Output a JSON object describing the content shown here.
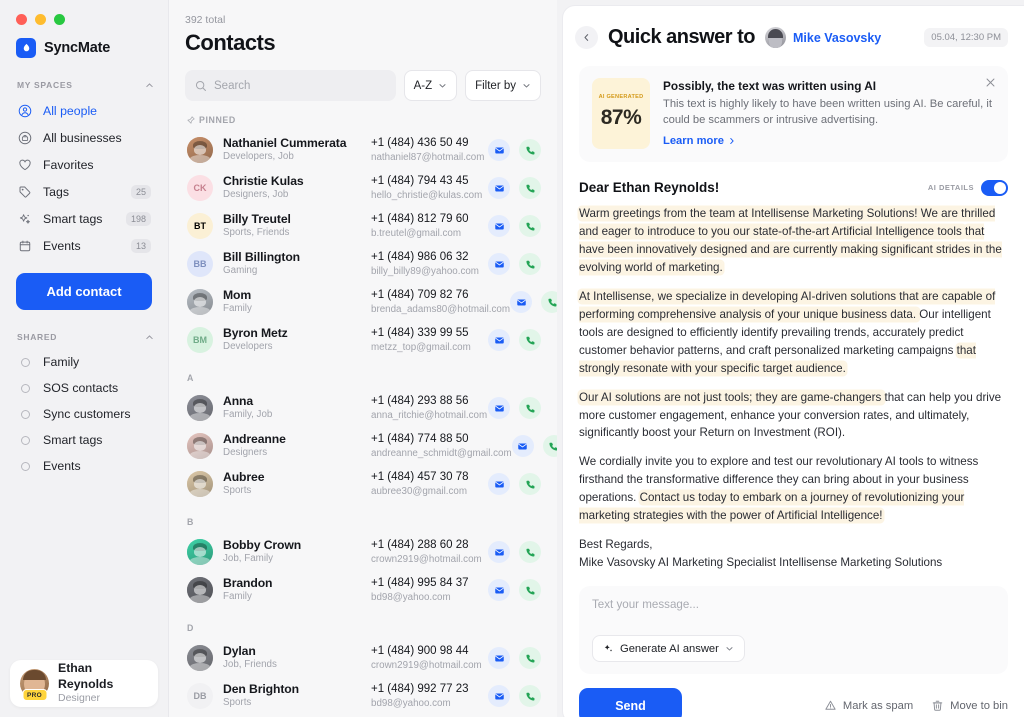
{
  "app": {
    "brand": "SyncMate"
  },
  "sidebar": {
    "my_spaces": {
      "title": "MY SPACES",
      "items": [
        {
          "label": "All people",
          "icon": "person-circle-icon",
          "badge": "",
          "active": true
        },
        {
          "label": "All businesses",
          "icon": "briefcase-circle-icon",
          "badge": "",
          "active": false
        },
        {
          "label": "Favorites",
          "icon": "heart-icon",
          "badge": "",
          "active": false
        },
        {
          "label": "Tags",
          "icon": "tag-icon",
          "badge": "25",
          "active": false
        },
        {
          "label": "Smart tags",
          "icon": "sparkles-icon",
          "badge": "198",
          "active": false
        },
        {
          "label": "Events",
          "icon": "calendar-icon",
          "badge": "13",
          "active": false
        }
      ]
    },
    "add_contact_label": "Add contact",
    "shared": {
      "title": "SHARED",
      "items": [
        {
          "label": "Family"
        },
        {
          "label": "SOS contacts"
        },
        {
          "label": "Sync customers"
        },
        {
          "label": "Smart tags"
        },
        {
          "label": "Events"
        }
      ]
    },
    "user": {
      "name": "Ethan Reynolds",
      "role": "Designer",
      "badge": "PRO"
    }
  },
  "contacts": {
    "total": "392 total",
    "title": "Contacts",
    "search_placeholder": "Search",
    "search_value": "",
    "sort_label": "A-Z",
    "filter_label": "Filter by",
    "groups": [
      {
        "label": "PINNED",
        "pinned": true,
        "rows": [
          {
            "name": "Nathaniel Cummerata",
            "tags": "Developers, Job",
            "phone": "+1 (484) 436 50 49",
            "email": "nathaniel87@hotmail.com",
            "initials": "NC",
            "avatar_type": "photo",
            "avatar_bg": "#c8906a",
            "avatar_fg": "#ffffff"
          },
          {
            "name": "Christie Kulas",
            "tags": "Designers, Job",
            "phone": "+1 (484) 794 43 45",
            "email": "hello_christie@kulas.com",
            "initials": "CK",
            "avatar_type": "initials",
            "avatar_bg": "#fbdfe4",
            "avatar_fg": "#c6808e"
          },
          {
            "name": "Billy Treutel",
            "tags": "Sports, Friends",
            "phone": "+1 (484) 812 79 60",
            "email": "b.treutel@gmail.com",
            "initials": "BT",
            "avatar_type": "initials",
            "avatar_bg": "#fbf0d5",
            "avatar_fg": "#c3a濃56"
          },
          {
            "name": "Bill Billington",
            "tags": "Gaming",
            "phone": "+1 (484) 986 06 32",
            "email": "billy_billy89@yahoo.com",
            "initials": "BB",
            "avatar_type": "initials",
            "avatar_bg": "#dfe6fa",
            "avatar_fg": "#7e8fbe"
          },
          {
            "name": "Mom",
            "tags": "Family",
            "phone": "+1 (484) 709 82 76",
            "email": "brenda_adams80@hotmail.com",
            "initials": "M",
            "avatar_type": "photo",
            "avatar_bg": "#b9bfc6",
            "avatar_fg": "#ffffff"
          },
          {
            "name": "Byron Metz",
            "tags": "Developers",
            "phone": "+1 (484) 339 99 55",
            "email": "metzz_top@gmail.com",
            "initials": "BM",
            "avatar_type": "initials",
            "avatar_bg": "#d8f2e0",
            "avatar_fg": "#70ab88"
          }
        ]
      },
      {
        "label": "A",
        "pinned": false,
        "rows": [
          {
            "name": "Anna",
            "tags": "Family, Job",
            "phone": "+1 (484) 293 88 56",
            "email": "anna_ritchie@hotmail.com",
            "initials": "A",
            "avatar_type": "photo",
            "avatar_bg": "#8d8f98",
            "avatar_fg": "#ffffff"
          },
          {
            "name": "Andreanne",
            "tags": "Designers",
            "phone": "+1 (484) 774 88 50",
            "email": "andreanne_schmidt@gmail.com",
            "initials": "A",
            "avatar_type": "photo",
            "avatar_bg": "#e6c6c0",
            "avatar_fg": "#ffffff"
          },
          {
            "name": "Aubree",
            "tags": "Sports",
            "phone": "+1 (484) 457 30 78",
            "email": "aubree30@gmail.com",
            "initials": "A",
            "avatar_type": "photo",
            "avatar_bg": "#ddc9a8",
            "avatar_fg": "#ffffff"
          }
        ]
      },
      {
        "label": "B",
        "pinned": false,
        "rows": [
          {
            "name": "Bobby Crown",
            "tags": "Job, Family",
            "phone": "+1 (484) 288 60 28",
            "email": "crown2919@hotmail.com",
            "initials": "BC",
            "avatar_type": "photo",
            "avatar_bg": "#3fd3a8",
            "avatar_fg": "#ffffff"
          },
          {
            "name": "Brandon",
            "tags": "Family",
            "phone": "+1 (484) 995 84 37",
            "email": "bd98@yahoo.com",
            "initials": "B",
            "avatar_type": "photo",
            "avatar_bg": "#6f7178",
            "avatar_fg": "#ffffff"
          }
        ]
      },
      {
        "label": "D",
        "pinned": false,
        "rows": [
          {
            "name": "Dylan",
            "tags": "Job, Friends",
            "phone": "+1 (484) 900 98 44",
            "email": "crown2919@hotmail.com",
            "initials": "D",
            "avatar_type": "photo",
            "avatar_bg": "#8b8d94",
            "avatar_fg": "#ffffff"
          },
          {
            "name": "Den Brighton",
            "tags": "Sports",
            "phone": "+1 (484) 992 77 23",
            "email": "bd98@yahoo.com",
            "initials": "DB",
            "avatar_type": "initials",
            "avatar_bg": "#f1f1f3",
            "avatar_fg": "#9a9ca4"
          }
        ]
      }
    ],
    "action_mail": "mail-icon",
    "action_call": "phone-icon"
  },
  "detail": {
    "title": "Quick answer to",
    "recipient": "Mike Vasovsky",
    "timestamp": "05.04, 12:30 PM",
    "ai_card": {
      "tag": "AI GENERATED",
      "percent": "87%",
      "title": "Possibly, the text was written using AI",
      "description": "This text is highly likely to have been written using AI. Be careful, it could be scammers or intrusive advertising.",
      "link": "Learn more"
    },
    "greeting": "Dear Ethan Reynolds!",
    "ai_details_label": "AI DETAILS",
    "ai_details_on": true,
    "paragraphs": [
      [
        {
          "t": "Warm greetings from the team at Intellisense Marketing Solutions! We are thrilled and eager to introduce to you our state-of-the-art Artificial Intelligence tools ",
          "h": true
        },
        {
          "t": "that have been innovatively designed and are currently making significant strides in the evolving world of marketing.",
          "h": true
        }
      ],
      [
        {
          "t": "At Intellisense, we specialize in developing AI-driven solutions that are capable of performing comprehensive analysis of your unique business data. ",
          "h": true
        },
        {
          "t": "Our intelligent tools are designed to efficiently identify prevailing trends, accurately predict customer behavior patterns, and craft personalized marketing campaigns ",
          "h": false
        },
        {
          "t": "that strongly resonate with your specific target audience.",
          "h": true
        }
      ],
      [
        {
          "t": "Our AI solutions are not just tools; they are game-changers ",
          "h": true
        },
        {
          "t": "that can help you drive more customer engagement, enhance your conversion rates, and ultimately, significantly boost your Return on Investment (ROI).",
          "h": false
        }
      ],
      [
        {
          "t": "We cordially invite you to explore and test our revolutionary AI tools to witness firsthand the transformative difference they can bring about in your business operations. ",
          "h": false
        },
        {
          "t": "Contact us today to embark on a journey of revolutionizing your marketing strategies with the power of Artificial Intelligence!",
          "h": true
        }
      ]
    ],
    "signature_line1": "Best Regards,",
    "signature_line2": "Mike Vasovsky AI Marketing Specialist Intellisense Marketing Solutions",
    "composer_placeholder": "Text your message...",
    "generate_label": "Generate AI answer",
    "send_label": "Send",
    "mark_spam_label": "Mark as spam",
    "move_bin_label": "Move to bin"
  },
  "colors": {
    "accent": "#1a5cf5",
    "ai_highlight": "#fcf4e3",
    "ai_badge": "#fdf3d8"
  }
}
